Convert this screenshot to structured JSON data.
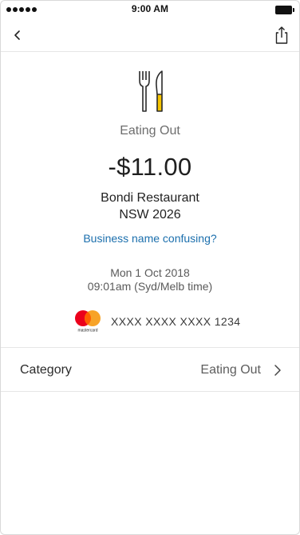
{
  "status_bar": {
    "time": "9:00 AM"
  },
  "nav": {
    "back_icon": "chevron-left-icon",
    "share_icon": "share-icon"
  },
  "transaction": {
    "icon": "cutlery-icon",
    "category": "Eating Out",
    "amount": "-$11.00",
    "merchant_name": "Bondi Restaurant",
    "merchant_location": "NSW 2026",
    "help_link": "Business name confusing?",
    "date": "Mon 1 Oct 2018",
    "time": "09:01am (Syd/Melb time)"
  },
  "card": {
    "brand_logo_text": "mastercard",
    "number": "XXXX XXXX XXXX 1234"
  },
  "category_row": {
    "label": "Category",
    "value": "Eating Out"
  },
  "colors": {
    "link": "#1b6fad",
    "accent_yellow": "#f5c400",
    "mastercard_red": "#eb001b",
    "mastercard_orange": "#f79e1b"
  }
}
